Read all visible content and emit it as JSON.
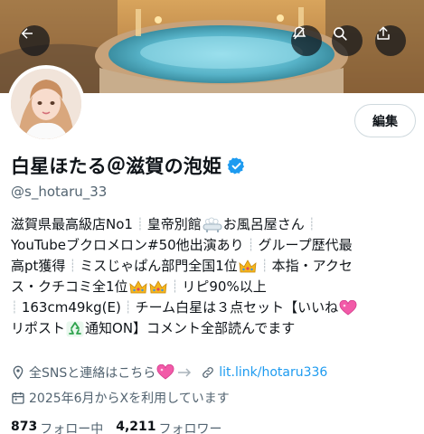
{
  "header": {
    "back_icon": "arrow-left-icon",
    "mute_icon": "no-bell-icon",
    "search_icon": "search-icon",
    "share_icon": "share-icon"
  },
  "profile": {
    "name": "白星ほたる＠滋賀の泡姫",
    "handle": "@s_hotaru_33",
    "edit_label": "編集",
    "verified_color": "#1d9bf0",
    "bio": {
      "l1a": "滋賀県最高級店No1",
      "l1b": "皇帝別館",
      "l1c": "お風呂屋さん",
      "l2a": "YouTubeブクロメロン#50他出演あり",
      "l2b": "グループ歴代最",
      "l3a": "高pt獲得",
      "l3b": "ミスじゃぱん部門全国1位",
      "l3c": "本指・アクセ",
      "l4a": "ス・クチコミ全1位",
      "l4b": "リピ90%以上",
      "l5a": "163cm49kg(E)",
      "l5b": "チーム白星は３点セット【いいね",
      "l6a": "リポスト",
      "l6b": "通知ON】コメント全部読んでます"
    },
    "location": "全SNSと連絡はこちら",
    "link": "lit.link/hotaru336",
    "joined": "2025年6月からXを利用しています",
    "following_count": "873",
    "following_label": "フォロー中",
    "followers_count": "4,211",
    "followers_label": "フォロワー"
  }
}
